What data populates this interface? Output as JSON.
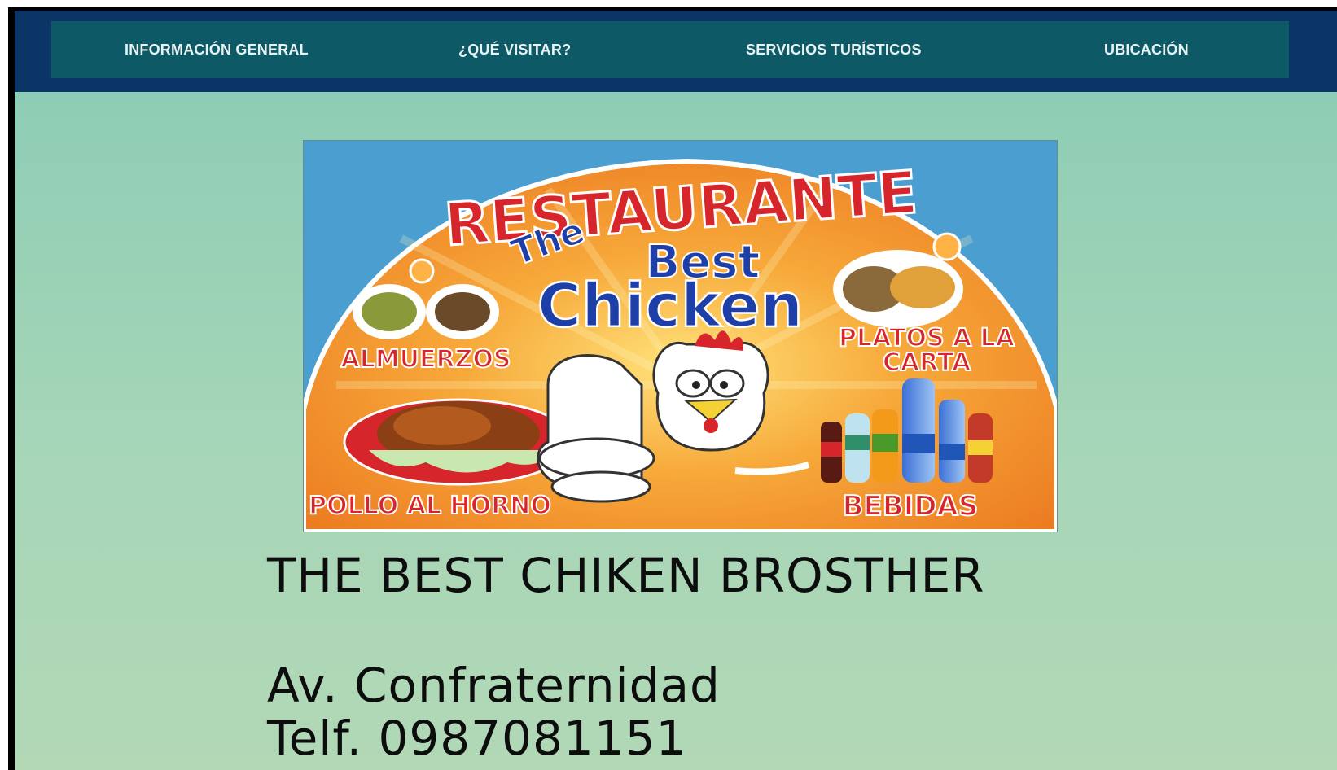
{
  "nav": {
    "items": [
      {
        "label": "INFORMACIÓN GENERAL"
      },
      {
        "label": "¿QUÉ VISITAR?"
      },
      {
        "label": "SERVICIOS TURÍSTICOS"
      },
      {
        "label": "UBICACIÓN"
      }
    ]
  },
  "sign": {
    "restaurante": "RESTAURANTE",
    "the": "The",
    "best": "Best",
    "chicken": "Chicken",
    "almuerzos": "ALMUERZOS",
    "platos_line1": "PLATOS A LA",
    "platos_line2": "CARTA",
    "pollo": "POLLO AL HORNO",
    "bebidas": "BEBIDAS"
  },
  "info": {
    "name": "THE BEST CHIKEN BROSTHER",
    "address": "Av. Confraternidad",
    "phone": "Telf. 0987081151"
  },
  "colors": {
    "nav_bg": "#0d5a66",
    "topbar_bg": "#0b3566",
    "content_bg": "#8ecdb5",
    "sign_orange": "#f29a2e",
    "sign_red": "#d7262b",
    "sign_blue": "#1f3fa8"
  }
}
